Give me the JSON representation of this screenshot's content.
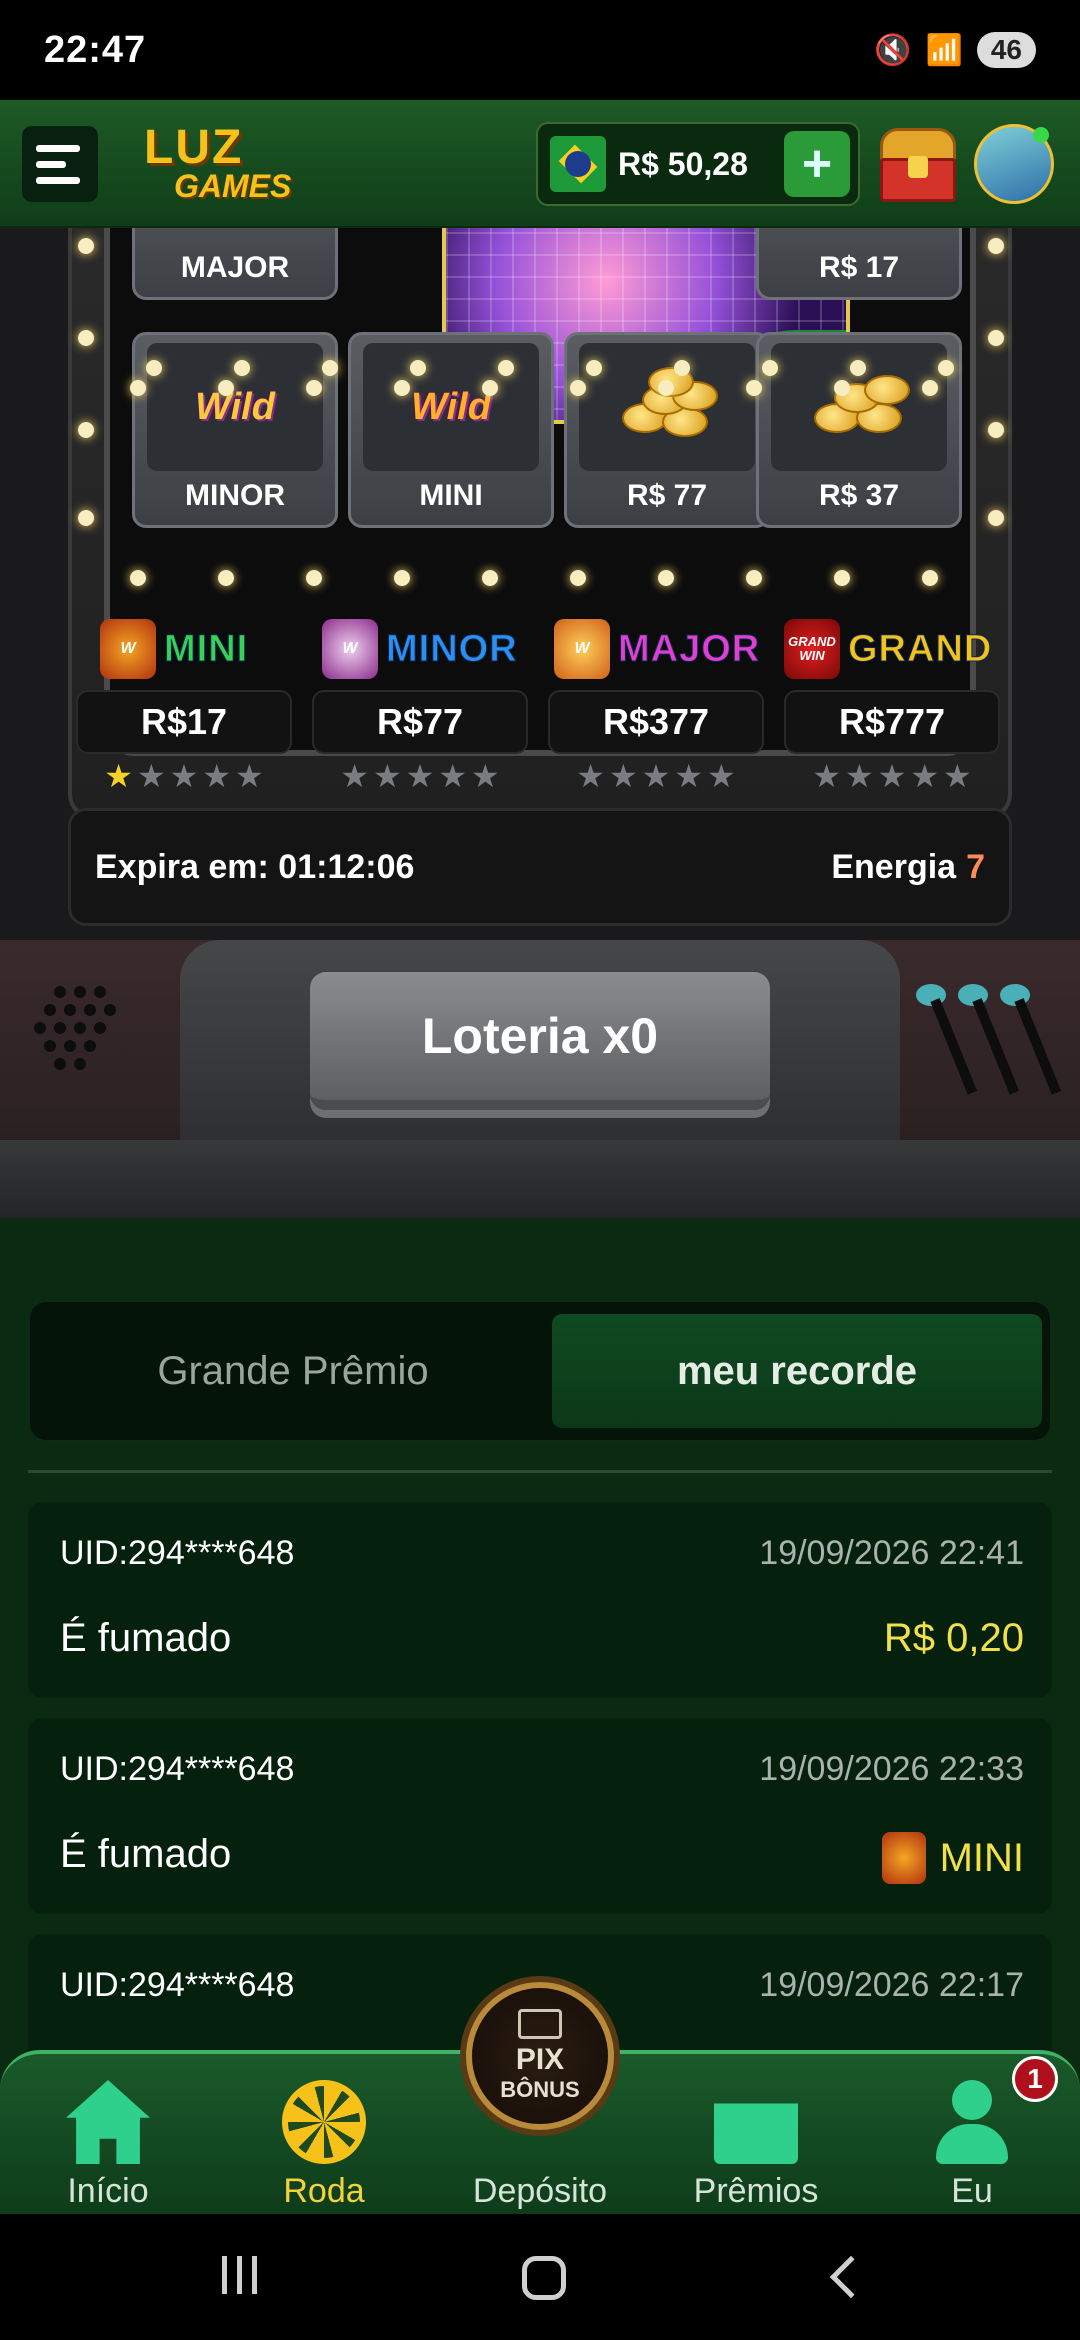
{
  "status_bar": {
    "time": "22:47",
    "battery": "46"
  },
  "header": {
    "logo_line1": "LUZ",
    "logo_line2": "GAMES",
    "balance": "R$ 50,28",
    "plus": "+"
  },
  "machine": {
    "tiles_top": [
      "MAJOR",
      "R$ 17"
    ],
    "tiles_bottom": [
      "MINOR",
      "MINI",
      "R$ 77",
      "R$ 37"
    ],
    "wild_text": "Wild",
    "jackpots": [
      {
        "name": "MINI",
        "amount": "R$17",
        "color": "#39d353",
        "stars_on": 1
      },
      {
        "name": "MINOR",
        "amount": "R$77",
        "color": "#2f8ff0",
        "stars_on": 0
      },
      {
        "name": "MAJOR",
        "amount": "R$377",
        "color": "#e23fd0",
        "stars_on": 0
      },
      {
        "name": "GRAND",
        "amount": "R$777",
        "color": "#f4c21a",
        "stars_on": 0
      }
    ],
    "grand_badge_top": "GRAND",
    "grand_badge_bottom": "WIN",
    "expira_label": "Expira em: 01:12:06",
    "energia_label": "Energia",
    "energia_value": "7",
    "button": "Loteria x0"
  },
  "tabs": {
    "grande_premio": "Grande Prêmio",
    "meu_recorde": "meu recorde"
  },
  "records": [
    {
      "uid": "UID:294****648",
      "date": "19/09/2026 22:41",
      "desc": "É fumado",
      "value": "R$ 0,20",
      "icon": false
    },
    {
      "uid": "UID:294****648",
      "date": "19/09/2026 22:33",
      "desc": "É fumado",
      "value": "MINI",
      "icon": true
    },
    {
      "uid": "UID:294****648",
      "date": "19/09/2026 22:17"
    }
  ],
  "bottom_nav": {
    "inicio": "Início",
    "roda": "Roda",
    "deposito": "Depósito",
    "premios": "Prêmios",
    "eu": "Eu",
    "badge": "1",
    "pix_top": "PIX",
    "pix_bottom": "BÔNUS"
  }
}
